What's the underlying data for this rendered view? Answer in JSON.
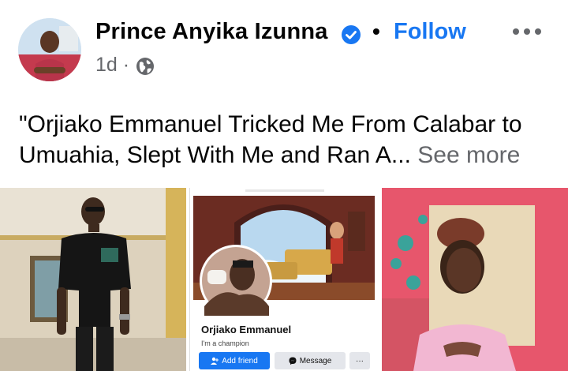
{
  "post": {
    "author": "Prince Anyika Izunna",
    "separator": "•",
    "follow_label": "Follow",
    "time": "1d ·",
    "text": "\"Orjiako Emmanuel Tricked Me From Calabar to Umuahia, Slept With Me and Ran A...",
    "see_more_label": "See more"
  },
  "embedded_profile": {
    "name": "Orjiako Emmanuel",
    "bio": "I'm a champion",
    "add_friend_label": "Add friend",
    "message_label": "Message",
    "more_label": "···"
  },
  "icons": [
    "verified-badge-icon",
    "more-options-icon",
    "globe-icon",
    "add-friend-icon",
    "messenger-icon"
  ],
  "colors": {
    "accent": "#1877f2",
    "secondary_text": "#65676b",
    "text": "#050505"
  }
}
